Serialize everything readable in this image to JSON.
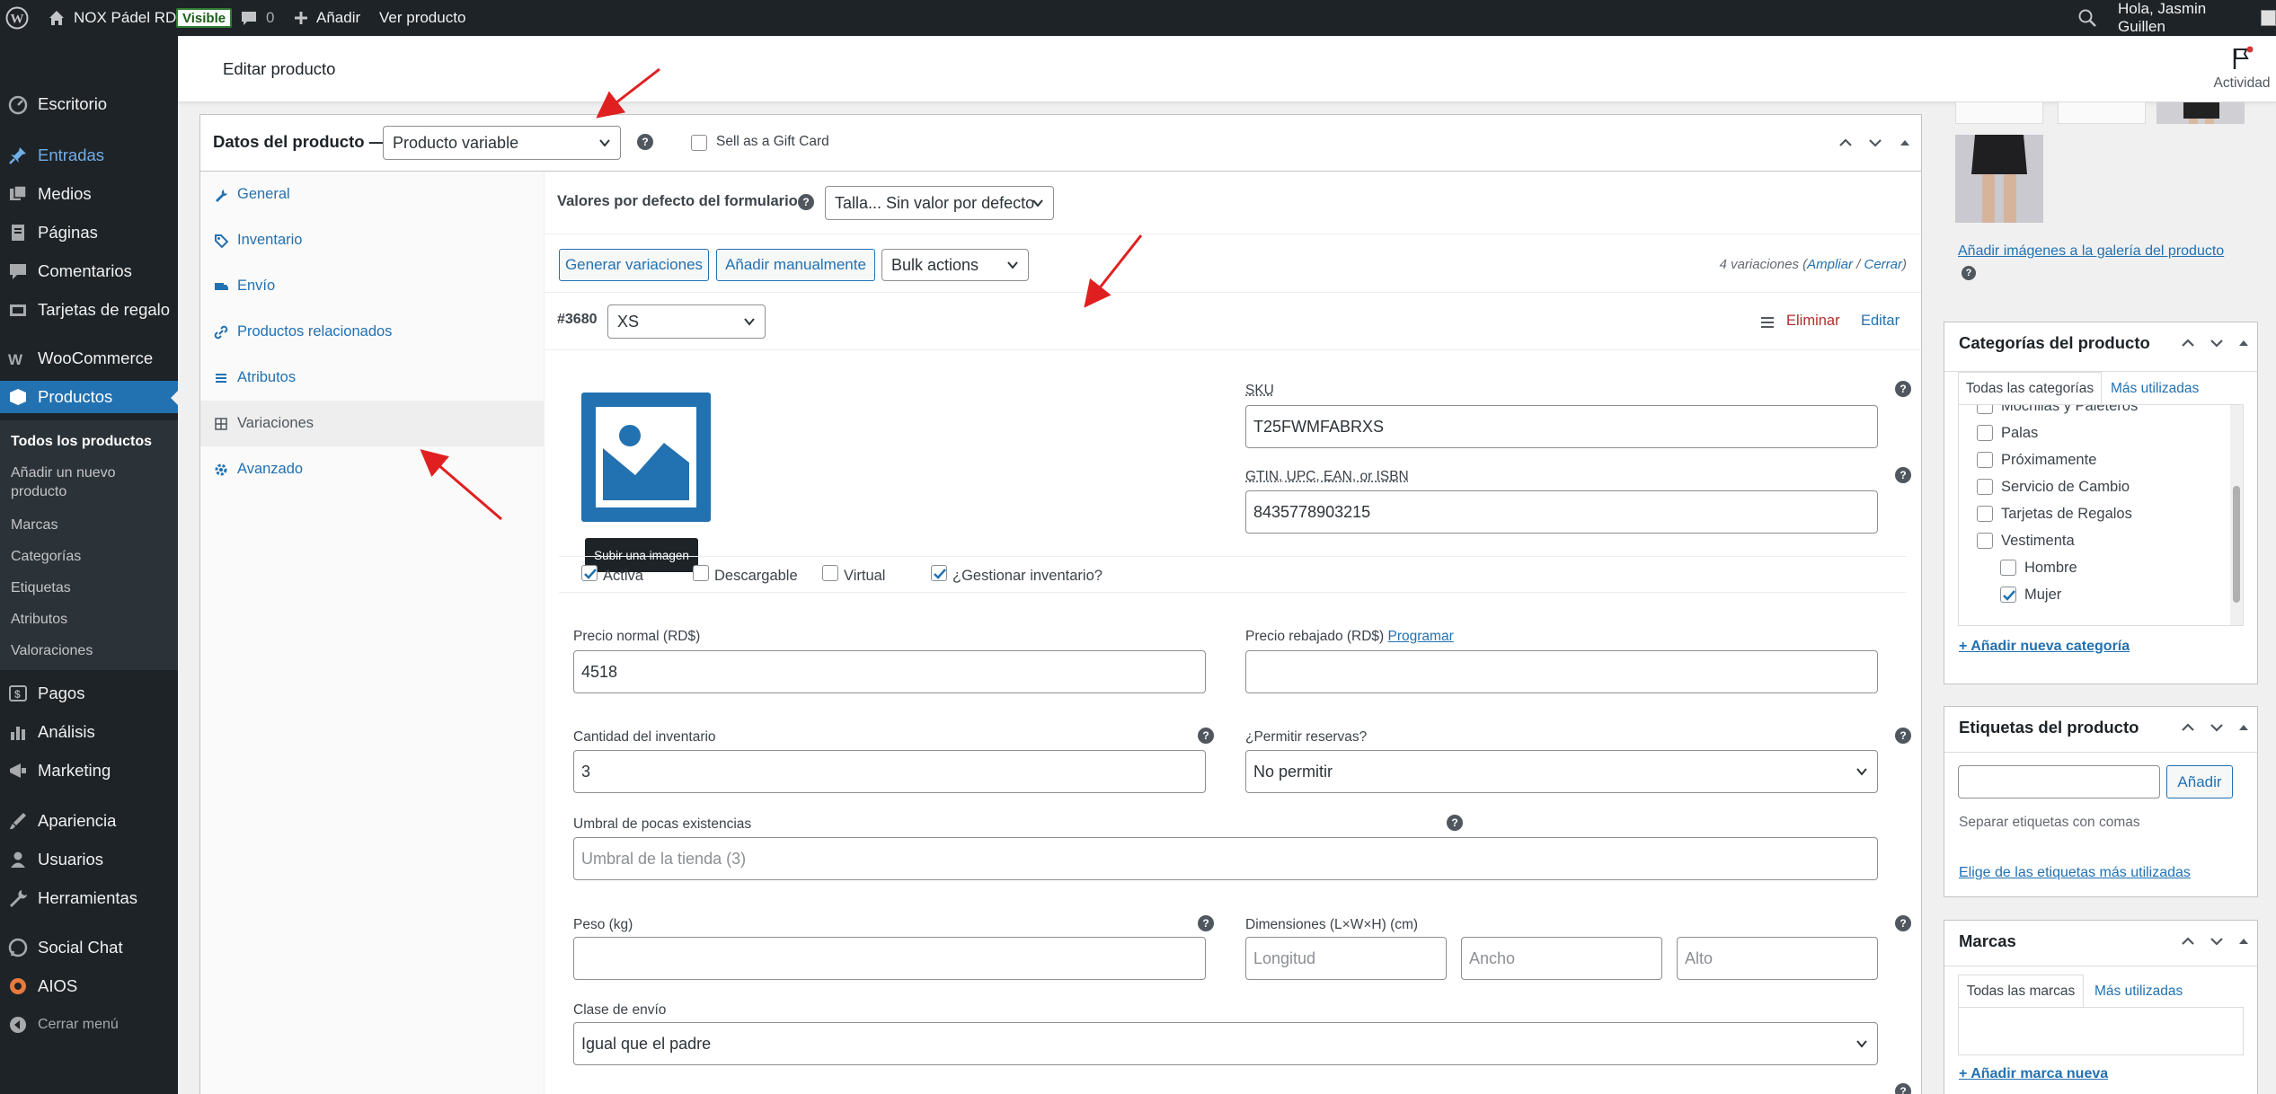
{
  "adminbar": {
    "site_name": "NOX Pádel RD",
    "visible_badge": "Visible",
    "comments_count": "0",
    "add_label": "Añadir",
    "view_product": "Ver producto",
    "greeting": "Hola, Jasmin Guillen"
  },
  "sidebar": {
    "items": [
      {
        "label": "Escritorio",
        "icon": "dashboard-icon"
      },
      {
        "label": "Entradas",
        "icon": "pin-icon"
      },
      {
        "label": "Medios",
        "icon": "media-icon"
      },
      {
        "label": "Páginas",
        "icon": "pages-icon"
      },
      {
        "label": "Comentarios",
        "icon": "comments-icon"
      },
      {
        "label": "Tarjetas de regalo",
        "icon": "gift-card-icon"
      },
      {
        "label": "WooCommerce",
        "icon": "woocommerce-icon"
      },
      {
        "label": "Productos",
        "icon": "products-icon"
      },
      {
        "label": "Pagos",
        "icon": "payments-icon"
      },
      {
        "label": "Análisis",
        "icon": "analytics-icon"
      },
      {
        "label": "Marketing",
        "icon": "marketing-icon"
      },
      {
        "label": "Apariencia",
        "icon": "appearance-icon"
      },
      {
        "label": "Usuarios",
        "icon": "users-icon"
      },
      {
        "label": "Herramientas",
        "icon": "tools-icon"
      },
      {
        "label": "Social Chat",
        "icon": "chat-icon"
      },
      {
        "label": "AIOS",
        "icon": "aios-icon"
      },
      {
        "label": "Cerrar menú",
        "icon": "collapse-icon"
      }
    ],
    "submenu": [
      "Todos los productos",
      "Añadir un nuevo producto",
      "Marcas",
      "Categorías",
      "Etiquetas",
      "Atributos",
      "Valoraciones"
    ]
  },
  "header": {
    "title": "Editar producto",
    "activity_label": "Actividad"
  },
  "product_data": {
    "title": "Datos del producto —",
    "type_select": "Producto variable",
    "gift_card_label": "Sell as a Gift Card",
    "tabs": [
      "General",
      "Inventario",
      "Envío",
      "Productos relacionados",
      "Atributos",
      "Variaciones",
      "Avanzado"
    ],
    "defaults_label": "Valores por defecto del formulario:",
    "defaults_select": "Talla... Sin valor por defecto",
    "generate_button": "Generar variaciones",
    "add_manual_button": "Añadir manualmente",
    "bulk_select": "Bulk actions",
    "variations_count": "4 variaciones (",
    "expand_link": "Ampliar",
    "sep": " / ",
    "close_link": "Cerrar",
    "count_end": ")"
  },
  "variation": {
    "id": "#3680",
    "size_select": "XS",
    "delete_link": "Eliminar",
    "edit_link": "Editar",
    "upload_tooltip": "Subir una imagen",
    "sku_label": "SKU",
    "sku_value": "T25FWMFABRXS",
    "gtin_label": "GTIN, UPC, EAN, or ISBN",
    "gtin_value": "8435778903215",
    "checks": [
      {
        "label": "Activa",
        "checked": true
      },
      {
        "label": "Descargable",
        "checked": false
      },
      {
        "label": "Virtual",
        "checked": false
      },
      {
        "label": "¿Gestionar inventario?",
        "checked": true
      }
    ],
    "regular_price_label": "Precio normal (RD$)",
    "regular_price_value": "4518",
    "sale_price_label": "Precio rebajado (RD$)",
    "schedule_link": "Programar",
    "stock_qty_label": "Cantidad del inventario",
    "stock_qty_value": "3",
    "backorders_label": "¿Permitir reservas?",
    "backorders_value": "No permitir",
    "low_stock_label": "Umbral de pocas existencias",
    "low_stock_placeholder": "Umbral de la tienda (3)",
    "weight_label": "Peso (kg)",
    "dimensions_label": "Dimensiones (L×W×H) (cm)",
    "length_placeholder": "Longitud",
    "width_placeholder": "Ancho",
    "height_placeholder": "Alto",
    "shipping_class_label": "Clase de envío",
    "shipping_class_value": "Igual que el padre"
  },
  "gallery": {
    "add_link": "Añadir imágenes a la galería del producto"
  },
  "categories": {
    "title": "Categorías del producto",
    "tab_all": "Todas las categorías",
    "tab_used": "Más utilizadas",
    "items": [
      {
        "label": "Mochilas y Paleteros",
        "checked": false,
        "child": false
      },
      {
        "label": "Palas",
        "checked": false,
        "child": false
      },
      {
        "label": "Próximamente",
        "checked": false,
        "child": false
      },
      {
        "label": "Servicio de Cambio",
        "checked": false,
        "child": false
      },
      {
        "label": "Tarjetas de Regalos",
        "checked": false,
        "child": false
      },
      {
        "label": "Vestimenta",
        "checked": false,
        "child": false
      },
      {
        "label": "Hombre",
        "checked": false,
        "child": true
      },
      {
        "label": "Mujer",
        "checked": true,
        "child": true
      }
    ],
    "add_link": "+ Añadir nueva categoría"
  },
  "tags": {
    "title": "Etiquetas del producto",
    "add_button": "Añadir",
    "hint": "Separar etiquetas con comas",
    "choose_link": "Elige de las etiquetas más utilizadas"
  },
  "brands": {
    "title": "Marcas",
    "tab_all": "Todas las marcas",
    "tab_used": "Más utilizadas",
    "add_link": "+ Añadir marca nueva"
  },
  "colors": {
    "accent": "#2271b1",
    "admin_dark": "#1d2327",
    "delete": "#b32d2e",
    "arrow": "#e02020"
  }
}
